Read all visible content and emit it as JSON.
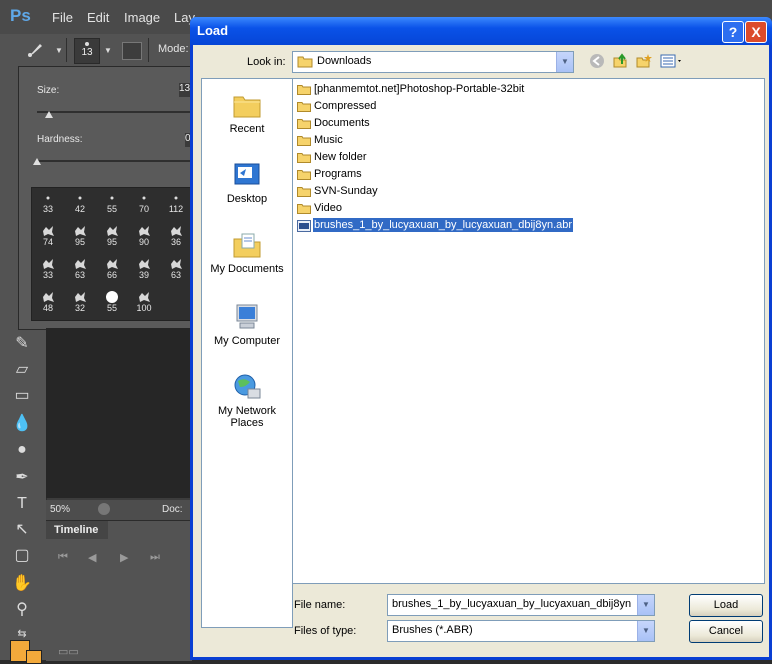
{
  "photoshop": {
    "logo": "Ps",
    "menu": [
      "File",
      "Edit",
      "Image",
      "Lay"
    ],
    "brush_size": "13",
    "mode_label": "Mode:",
    "panel": {
      "size_label": "Size:",
      "size_value": "13",
      "hardness_label": "Hardness:",
      "hardness_value": "0",
      "brushes": [
        [
          "33",
          "42",
          "55",
          "70",
          "112"
        ],
        [
          "74",
          "95",
          "95",
          "90",
          "36"
        ],
        [
          "33",
          "63",
          "66",
          "39",
          "63"
        ],
        [
          "48",
          "32",
          "55",
          "100",
          ""
        ]
      ]
    },
    "zoom": "50%",
    "doc_label": "Doc:",
    "timeline_tab": "Timeline"
  },
  "dialog": {
    "title": "Load",
    "help_label": "?",
    "close_label": "X",
    "look_in_label": "Look in:",
    "look_in_value": "Downloads",
    "places": [
      "Recent",
      "Desktop",
      "My Documents",
      "My Computer",
      "My Network Places"
    ],
    "files": [
      {
        "name": "[phanmemtot.net]Photoshop-Portable-32bit",
        "type": "folder"
      },
      {
        "name": "Compressed",
        "type": "folder"
      },
      {
        "name": "Documents",
        "type": "folder"
      },
      {
        "name": "Music",
        "type": "folder"
      },
      {
        "name": "New folder",
        "type": "folder"
      },
      {
        "name": "Programs",
        "type": "folder"
      },
      {
        "name": "SVN-Sunday",
        "type": "folder"
      },
      {
        "name": "Video",
        "type": "folder"
      },
      {
        "name": "brushes_1_by_lucyaxuan_by_lucyaxuan_dbij8yn.abr",
        "type": "abr",
        "selected": true
      }
    ],
    "file_name_label": "File name:",
    "file_name_value": "brushes_1_by_lucyaxuan_by_lucyaxuan_dbij8yn",
    "file_type_label": "Files of type:",
    "file_type_value": "Brushes (*.ABR)",
    "load_button": "Load",
    "cancel_button": "Cancel"
  },
  "colors": {
    "xp_titlebar": "#0a52e8",
    "selection": "#316ac5",
    "ps_foreground": "#f2a93b"
  }
}
